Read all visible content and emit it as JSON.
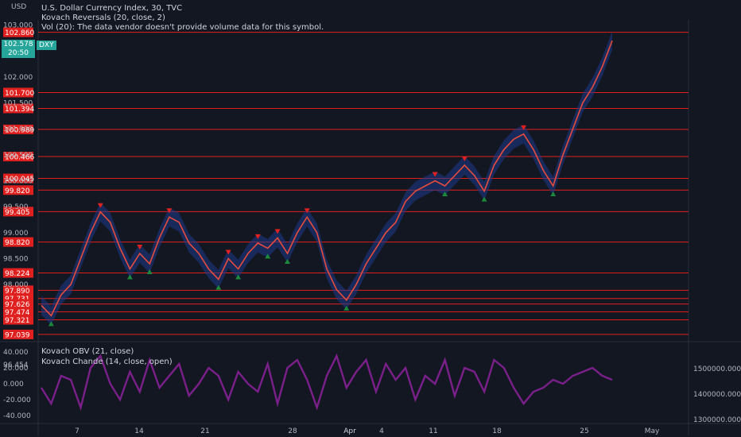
{
  "header": {
    "currency": "USD"
  },
  "legend": {
    "title": "U.S. Dollar Currency Index, 30, TVC",
    "indicator1": "Kovach Reversals (20, close, 2)",
    "indicator2": "Vol (20): The data vendor doesn't provide volume data for this symbol.",
    "osc1": "Kovach OBV (21, close)",
    "osc2": "Kovach Chande (14, close, open)"
  },
  "last_price": {
    "value": "102.578",
    "time": "20:50",
    "symbol": "DXY"
  },
  "colors": {
    "background": "#131722",
    "level_line": "#e0201f",
    "up_arrow": "#1b8a3a",
    "down_arrow": "#e0201f",
    "price_line": "#e74c3c",
    "band": "#1e3a8a",
    "oscillator": "#7b1f8a",
    "tag": "#26a69a"
  },
  "chart_data": [
    {
      "type": "line",
      "title": "U.S. Dollar Currency Index, 30, TVC",
      "y_axis_ticks": [
        "103.000",
        "102.000",
        "101.500",
        "101.000",
        "100.500",
        "100.000",
        "99.500",
        "99.000",
        "98.500",
        "98.000",
        "96.454"
      ],
      "ylim": [
        96.9,
        103.1
      ],
      "x_axis_labels": [
        "7",
        "14",
        "21",
        "28",
        "Apr",
        "4",
        "11",
        "18",
        "25",
        "May"
      ],
      "horizontal_levels": [
        "102.860",
        "101.700",
        "101.394",
        "100.989",
        "100.466",
        "100.045",
        "99.820",
        "99.405",
        "98.820",
        "98.224",
        "97.890",
        "97.731",
        "97.626",
        "97.474",
        "97.321",
        "97.039"
      ],
      "series": [
        {
          "values": [
            97.6,
            97.4,
            97.8,
            98.0,
            98.5,
            99.0,
            99.4,
            99.2,
            98.7,
            98.3,
            98.6,
            98.4,
            98.9,
            99.3,
            99.2,
            98.8,
            98.6,
            98.3,
            98.1,
            98.5,
            98.3,
            98.6,
            98.8,
            98.7,
            98.9,
            98.6,
            99.0,
            99.3,
            99.0,
            98.3,
            97.9,
            97.7,
            98.0,
            98.4,
            98.7,
            99.0,
            99.2,
            99.6,
            99.8,
            99.9,
            100.0,
            99.9,
            100.1,
            100.3,
            100.1,
            99.8,
            100.3,
            100.6,
            100.8,
            100.9,
            100.6,
            100.2,
            99.9,
            100.5,
            101.0,
            101.5,
            101.8,
            102.2,
            102.7
          ]
        }
      ]
    },
    {
      "type": "line",
      "title": "",
      "y_axis_ticks": [
        "40.000",
        "20.000",
        "0.000",
        "-20.000",
        "-40.000"
      ],
      "right_axis_ticks": [
        "1500000.000",
        "1400000.000",
        "1300000.000"
      ],
      "ylim": [
        -45,
        45
      ],
      "series": [
        {
          "values": [
            -5,
            -25,
            10,
            5,
            -30,
            20,
            35,
            0,
            -20,
            15,
            -10,
            30,
            -5,
            10,
            25,
            -15,
            0,
            20,
            10,
            -20,
            15,
            0,
            -10,
            25,
            -25,
            20,
            30,
            5,
            -30,
            10,
            35,
            -5,
            15,
            30,
            -10,
            25,
            5,
            20,
            -20,
            10,
            0,
            30,
            -15,
            20,
            15,
            -10,
            30,
            20,
            -5,
            -25,
            -10,
            -5,
            5,
            0,
            10,
            15,
            20,
            10,
            5
          ]
        }
      ]
    }
  ]
}
